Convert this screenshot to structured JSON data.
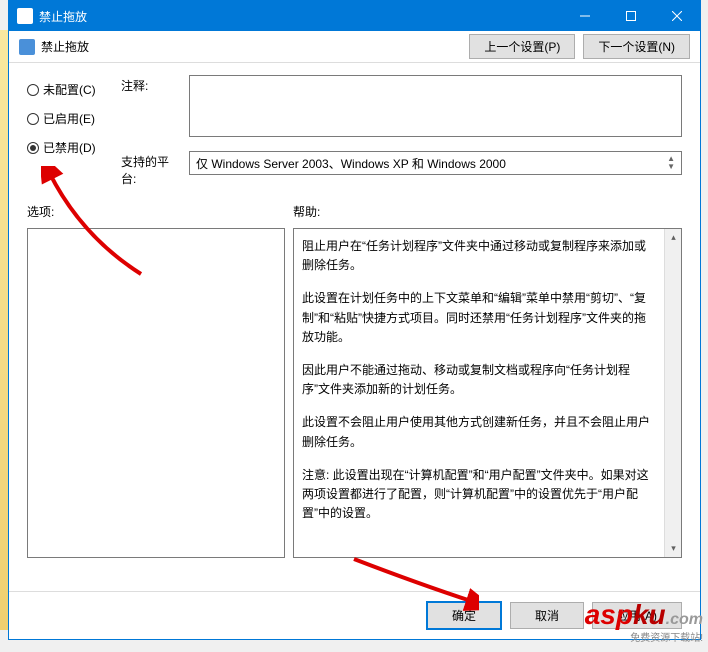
{
  "titlebar": {
    "title": "禁止拖放"
  },
  "subheader": {
    "title": "禁止拖放"
  },
  "nav": {
    "prev": "上一个设置(P)",
    "next": "下一个设置(N)"
  },
  "radios": {
    "not_configured": "未配置(C)",
    "enabled": "已启用(E)",
    "disabled": "已禁用(D)"
  },
  "labels": {
    "comment": "注释:",
    "platform": "支持的平台:",
    "options": "选项:",
    "help": "帮助:"
  },
  "platform_text": "仅 Windows Server 2003、Windows XP 和 Windows 2000",
  "help": {
    "p1": "阻止用户在“任务计划程序”文件夹中通过移动或复制程序来添加或删除任务。",
    "p2": "此设置在计划任务中的上下文菜单和“编辑”菜单中禁用“剪切”、“复制”和“粘贴”快捷方式项目。同时还禁用“任务计划程序”文件夹的拖放功能。",
    "p3": "因此用户不能通过拖动、移动或复制文档或程序向“任务计划程序”文件夹添加新的计划任务。",
    "p4": "此设置不会阻止用户使用其他方式创建新任务，并且不会阻止用户删除任务。",
    "p5": "注意: 此设置出现在“计算机配置”和“用户配置”文件夹中。如果对这两项设置都进行了配置，则“计算机配置”中的设置优先于“用户配置”中的设置。"
  },
  "buttons": {
    "ok": "确定",
    "cancel": "取消",
    "apply": "应用(A)"
  },
  "watermark": {
    "main1": "asp",
    "main2": "ku",
    "suffix": ".com",
    "sub": "免费资源下载站!"
  }
}
